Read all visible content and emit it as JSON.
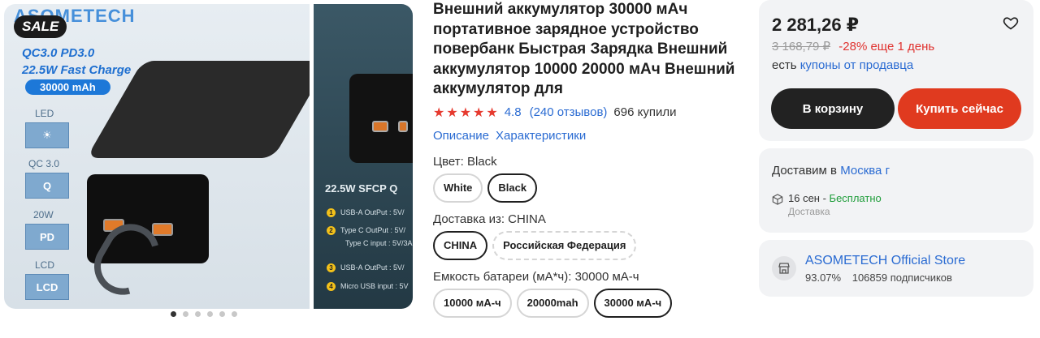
{
  "gallery": {
    "brand": "ASOMETECH",
    "sale_badge": "SALE",
    "promo_line1": "QC3.0 PD3.0",
    "promo_line2": "22.5W Fast Charge",
    "capacity_badge": "30000 mAh",
    "features": [
      {
        "label": "LED",
        "icon": "bulb-icon",
        "icon_text": "☀"
      },
      {
        "label": "QC 3.0",
        "icon": "quick-charge-icon",
        "icon_text": "Q"
      },
      {
        "label": "20W",
        "icon": "pd-icon",
        "icon_text": "PD"
      },
      {
        "label": "LCD",
        "icon": "lcd-icon",
        "icon_text": "LCD"
      }
    ],
    "second_title": "22.5W SFCP Q",
    "specs": [
      {
        "num": "1",
        "text": "USB-A OutPut : 5V/"
      },
      {
        "num": "2",
        "text": "Type C OutPut : 5V/"
      },
      {
        "num": "",
        "text": "Type C input : 5V/3A"
      },
      {
        "num": "3",
        "text": "USB-A OutPut : 5V/"
      },
      {
        "num": "4",
        "text": "Micro USB input : 5V"
      }
    ],
    "dots_total": 6,
    "dots_active": 0
  },
  "product": {
    "title": "Внешний аккумулятор 30000 мАч портативное зарядное устройство повербанк Быстрая Зарядка Внешний аккумулятор 10000 20000 мАч Внешний аккумулятор для",
    "stars": "★★★★★",
    "rating": "4.8",
    "reviews": "(240 отзывов)",
    "sold": "696 купили",
    "tabs": [
      "Описание",
      "Характеристики"
    ],
    "color_label": "Цвет: Black",
    "colors": [
      {
        "label": "White",
        "selected": false
      },
      {
        "label": "Black",
        "selected": true
      }
    ],
    "ship_label": "Доставка из: CHINA",
    "ship_from": [
      {
        "label": "CHINA",
        "selected": true
      },
      {
        "label": "Российская Федерация",
        "selected": false
      }
    ],
    "capacity_label": "Емкость батареи (мА*ч): 30000 мА-ч",
    "capacities": [
      {
        "label": "10000 мА-ч",
        "selected": false
      },
      {
        "label": "20000mah",
        "selected": false
      },
      {
        "label": "30000 мА-ч",
        "selected": true
      }
    ]
  },
  "buy": {
    "price": "2 281,26 ₽",
    "old_price": "3 168,79 ₽",
    "discount": "-28% еще 1 день",
    "coupon_prefix": "есть",
    "coupon_link": "купоны от продавца",
    "cart_button": "В корзину",
    "buy_button": "Купить сейчас"
  },
  "delivery": {
    "title_prefix": "Доставим в",
    "city": "Москва г",
    "date": "16 сен -",
    "free": "Бесплатно",
    "sub": "Доставка"
  },
  "store": {
    "name": "ASOMETECH Official Store",
    "rating": "93.07%",
    "subscribers": "106859 подписчиков"
  },
  "colors": {
    "accent_link": "#2a6bd2",
    "star": "#e63a2f",
    "buy_button": "#e03a1f",
    "cart_button": "#222222",
    "free": "#1f9d3a"
  }
}
